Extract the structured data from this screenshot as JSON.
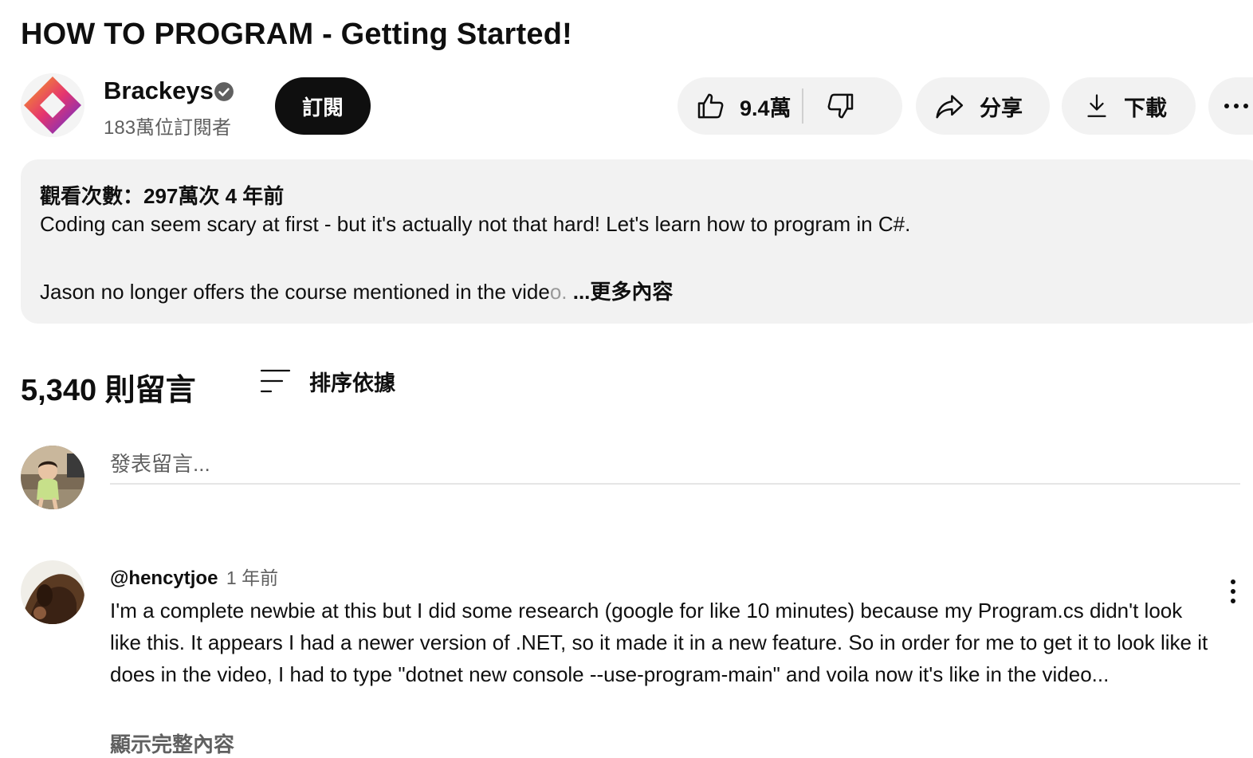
{
  "video": {
    "title": "HOW TO PROGRAM - Getting Started!"
  },
  "channel": {
    "name": "Brackeys",
    "subscribers": "183萬位訂閱者",
    "subscribe_label": "訂閱"
  },
  "actions": {
    "likes": "9.4萬",
    "share_label": "分享",
    "download_label": "下載"
  },
  "description": {
    "meta": "觀看次數：297萬次  4 年前",
    "line1": "Coding can seem scary at first - but it's actually not that hard! Let's learn how to program in C#.",
    "line2": "Jason no longer offers the course mentioned in the vide",
    "line2_fade": "o.",
    "more_label": " ...更多內容"
  },
  "comments": {
    "count_label": "5,340 則留言",
    "sort_label": "排序依據",
    "input_placeholder": "發表留言...",
    "items": [
      {
        "author": "@hencytjoe",
        "time": "1 年前",
        "text": "I'm a complete newbie at this but I did some research (google for like 10 minutes) because my Program.cs didn't look like this. It appears I had a newer version of .NET, so it made it in a new feature. So in order for me to get it to look like it does in the video, I had to type \"dotnet new console --use-program-main\" and voila now it's like in the video...",
        "expand_label": "顯示完整內容"
      }
    ]
  },
  "icons": {
    "verified": "verified-check-icon",
    "like": "thumbs-up-icon",
    "dislike": "thumbs-down-icon",
    "share": "share-arrow-icon",
    "download": "download-icon",
    "more": "more-horizontal-icon",
    "sort": "sort-lines-icon",
    "comment_menu": "more-vertical-icon"
  },
  "colors": {
    "text": "#0f0f0f",
    "secondary": "#606060",
    "pill_bg": "#f2f2f2",
    "subscribe_bg": "#0f0f0f"
  }
}
